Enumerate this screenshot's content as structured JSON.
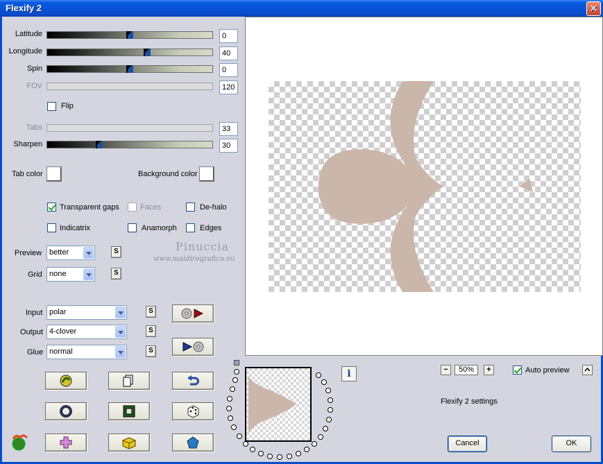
{
  "window": {
    "title": "Flexify 2",
    "close_glyph": "✕"
  },
  "sliders": [
    {
      "label": "Latitude",
      "value": "0",
      "position": 0.5,
      "disabled": false
    },
    {
      "label": "Longitude",
      "value": "40",
      "position": 0.61,
      "disabled": false
    },
    {
      "label": "Spin",
      "value": "0",
      "position": 0.5,
      "disabled": false
    },
    {
      "label": "FOV",
      "value": "120",
      "disabled": true
    },
    {
      "label": "Tabs",
      "value": "33",
      "disabled": true
    },
    {
      "label": "Sharpen",
      "value": "30",
      "position": 0.3,
      "disabled": false
    }
  ],
  "flip": {
    "label": "Flip",
    "checked": false
  },
  "colors": {
    "tab_color_label": "Tab color",
    "background_color_label": "Background color"
  },
  "options": {
    "transparent_gaps": {
      "label": "Transparent gaps",
      "checked": true
    },
    "faces": {
      "label": "Faces",
      "checked": false,
      "disabled": true
    },
    "de_halo": {
      "label": "De-halo",
      "checked": false
    },
    "indicatrix": {
      "label": "Indicatrix",
      "checked": false
    },
    "anamorph": {
      "label": "Anamorph",
      "checked": false
    },
    "edges": {
      "label": "Edges",
      "checked": false
    }
  },
  "preview_select": {
    "label": "Preview",
    "value": "better"
  },
  "grid_select": {
    "label": "Grid",
    "value": "none"
  },
  "input_select": {
    "label": "Input",
    "value": "polar"
  },
  "output_select": {
    "label": "Output",
    "value": "4-clover"
  },
  "glue_select": {
    "label": "Glue",
    "value": "normal"
  },
  "s_button_label": "S",
  "watermark": {
    "name": "Pinuccia",
    "site": "www.maidiregrafica.eu"
  },
  "zoom": {
    "value": "50%",
    "minus": "−",
    "plus": "+"
  },
  "auto_preview": {
    "label": "Auto preview",
    "checked": true
  },
  "settings_label": "Flexify 2 settings",
  "info_glyph": "i",
  "buttons": {
    "cancel": "Cancel",
    "ok": "OK"
  },
  "colors_hex": {
    "shape": "#cbb6aa",
    "title_bar": "#0553d6",
    "panel": "#d4d5df"
  },
  "icons": [
    "swap-input-output-icon",
    "swap-output-input-icon",
    "randomize-icon",
    "copy-icon",
    "undo-icon",
    "ring-icon",
    "square-frame-icon",
    "dice-icon",
    "flexify-logo-icon",
    "cross-icon",
    "cube-icon",
    "pentagon-icon"
  ]
}
